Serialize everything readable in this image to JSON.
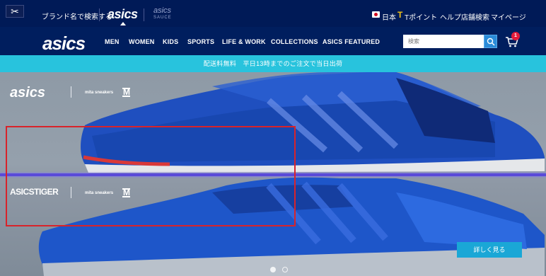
{
  "utility_bar": {
    "search_by_brand": "ブランド名で検索する",
    "brand_asics": "asics",
    "brand_tiger": "asics",
    "brand_tiger_sub": "SAUCE",
    "country": "日本",
    "tpoint": "Tポイント",
    "help": "ヘルプ",
    "store_search": "店舗検索",
    "mypage": "マイページ"
  },
  "main_nav": {
    "logo": "asics",
    "items": [
      "MEN",
      "WOMEN",
      "KIDS",
      "SPORTS",
      "LIFE & WORK",
      "COLLECTIONS",
      "ASICS FEATURED"
    ],
    "search_placeholder": "検索",
    "cart_count": "1"
  },
  "announcement": "配送料無料　平日13時までのご注文で当日出荷",
  "hero": {
    "logo_top": "asics",
    "logo_bottom": "ASICSTIGER",
    "collab": "mita sneakers",
    "m_mark": "M",
    "cta": "詳しく見る",
    "carousel_dots": [
      true,
      false
    ]
  },
  "colors": {
    "nav_bg": "#001e5e",
    "announce_bg": "#28c3dd",
    "cta_bg": "#1aa7d6",
    "cart_badge": "#e31b3a",
    "shoe_blue": "#1f4fbf"
  }
}
